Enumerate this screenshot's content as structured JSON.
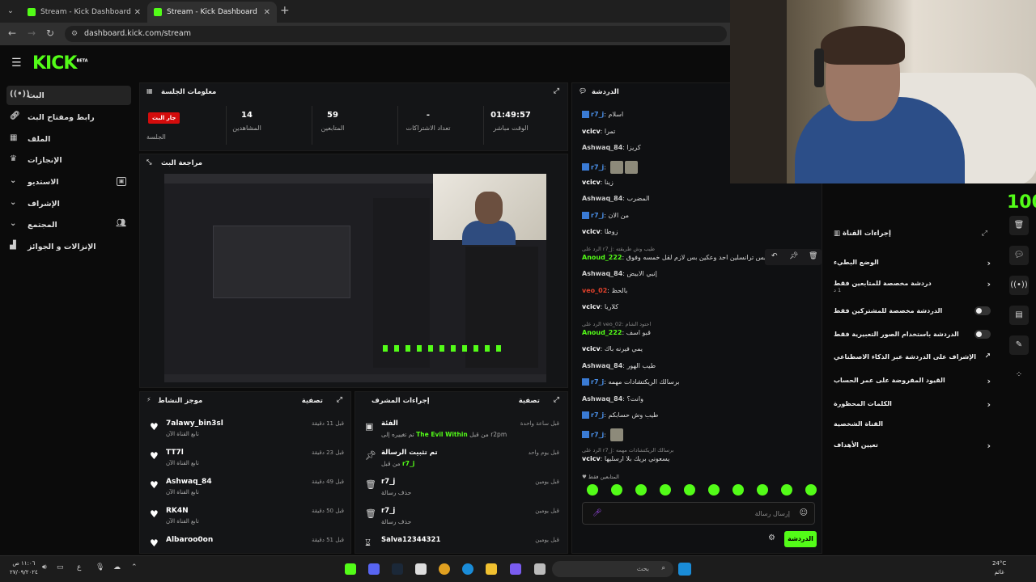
{
  "browser": {
    "tabs": [
      {
        "title": "Stream - Kick Dashboard"
      },
      {
        "title": "Stream - Kick Dashboard"
      }
    ],
    "url": "dashboard.kick.com/stream",
    "new_tab": "+",
    "close": "✕"
  },
  "logo": {
    "text": "KICK",
    "beta": "BETA"
  },
  "sidebar": {
    "items": [
      {
        "label": "البث",
        "icon": "stream-icon"
      },
      {
        "label": "رابط ومفتاح البث",
        "icon": "link-icon"
      },
      {
        "label": "الملف",
        "icon": "file-icon"
      },
      {
        "label": "الإنجازات",
        "icon": "trophy-icon"
      },
      {
        "label": "الاستديو",
        "icon": "chevron-down-icon"
      },
      {
        "label": "الإشراف",
        "icon": "chevron-down-icon"
      },
      {
        "label": "المجتمع",
        "icon": "chevron-down-icon"
      },
      {
        "label": "الإنزالات و الجوائز",
        "icon": "gift-icon"
      }
    ]
  },
  "session": {
    "title": "معلومات الجلسة",
    "live_badge": "جار البث",
    "session_label": "الجلسة",
    "stats": [
      {
        "value": "14",
        "label": "المشاهدين"
      },
      {
        "value": "59",
        "label": "المتابعين"
      },
      {
        "value": "-",
        "label": "تعداد الاشتراكات"
      },
      {
        "value": "01:49:57",
        "label": "الوقت مباشر"
      }
    ]
  },
  "preview": {
    "title": "مراجعة البث"
  },
  "activity": {
    "title": "موجز النشاط",
    "filter": "تصفية",
    "items": [
      {
        "name": "7alawy_bin3sl",
        "sub": "تابع القناة الآن",
        "time": "قبل 11 دقيقة"
      },
      {
        "name": "TT7l",
        "sub": "تابع القناة الآن",
        "time": "قبل 23 دقيقة"
      },
      {
        "name": "Ashwaq_84",
        "sub": "تابع القناة الآن",
        "time": "قبل 49 دقيقة"
      },
      {
        "name": "RK4N",
        "sub": "تابع القناة الآن",
        "time": "قبل 50 دقيقة"
      },
      {
        "name": "Albaroo0on",
        "sub": "",
        "time": "قبل 51 دقيقة"
      }
    ]
  },
  "moderation": {
    "title": "إجراءات المشرف",
    "filter": "تصفية",
    "items": [
      {
        "name": "الفئة",
        "sub_pre": "تم تغييره إلى ",
        "sub_hl": "The Evil Within",
        "sub_post": " من قبل r2pm",
        "time": "قبل ساعة واحدة",
        "icon": "category-icon"
      },
      {
        "name": "تم تثبيت الرسالة",
        "sub_pre": "من قبل ",
        "sub_hl": "r7_j",
        "sub_post": "",
        "time": "قبل يوم واحد",
        "icon": "pin-icon"
      },
      {
        "name": "r7_j",
        "sub_pre": "حذف رسالة",
        "sub_hl": "",
        "sub_post": "",
        "time": "قبل يومين",
        "icon": "trash-icon"
      },
      {
        "name": "r7_j",
        "sub_pre": "حذف رسالة",
        "sub_hl": "",
        "sub_post": "",
        "time": "قبل يومين",
        "icon": "trash-icon"
      },
      {
        "name": "Salva12344321",
        "sub_pre": "",
        "sub_hl": "",
        "sub_post": "",
        "time": "قبل يومين",
        "icon": "hourglass-icon"
      }
    ]
  },
  "chat": {
    "title": "الدردشة",
    "messages": [
      {
        "user": "r7_j",
        "color": "#4a8fe8",
        "text": "اسلام",
        "badge": true
      },
      {
        "user": "vcicv",
        "color": "#ffffff",
        "text": "تمرا",
        "badge": false
      },
      {
        "user": "Ashwaq_84",
        "color": "#cfcfcf",
        "text": "كريزا",
        "badge": false
      },
      {
        "user": "r7_j",
        "color": "#4a8fe8",
        "text": "",
        "badge": true,
        "emotes": 2
      },
      {
        "user": "vcicv",
        "color": "#ffffff",
        "text": "زينا",
        "badge": false
      },
      {
        "user": "Ashwaq_84",
        "color": "#cfcfcf",
        "text": "المضرب",
        "badge": false
      },
      {
        "user": "r7_j",
        "color": "#4a8fe8",
        "text": "من الان",
        "badge": true
      },
      {
        "user": "vcicv",
        "color": "#ffffff",
        "text": "زوطا",
        "badge": false
      },
      {
        "ref": "الرد على r7_j: طيب وش طريقته",
        "user": "Anoud_222",
        "color": "#53fc18",
        "text": "س جاكو بس ترانسلين احد وعكين بس لازم لقل خمسه وفوق",
        "badge": false
      },
      {
        "user": "Ashwaq_84",
        "color": "#cfcfcf",
        "text": "إنبي الابيض",
        "badge": false
      },
      {
        "user": "veo_02",
        "color": "#e0412b",
        "text": "بالحظ",
        "badge": false
      },
      {
        "user": "vcicv",
        "color": "#ffffff",
        "text": "كلاريا",
        "badge": false
      },
      {
        "ref": "الرد على veo_02: احتود الشام",
        "user": "Anoud_222",
        "color": "#53fc18",
        "text": "قبو اسف",
        "badge": false
      },
      {
        "user": "vcicv",
        "color": "#ffffff",
        "text": "يمي فيرنه باك",
        "badge": false
      },
      {
        "user": "Ashwaq_84",
        "color": "#cfcfcf",
        "text": "طيب الهور",
        "badge": false
      },
      {
        "user": "r7_j",
        "color": "#4a8fe8",
        "text": "برسالك الريكتشادات مهمه",
        "badge": true
      },
      {
        "user": "Ashwaq_84",
        "color": "#cfcfcf",
        "text": "وانت؟",
        "badge": false
      },
      {
        "user": "r7_j",
        "color": "#4a8fe8",
        "text": "طيب وش حسابكم",
        "badge": true
      },
      {
        "user": "r7_j",
        "color": "#4a8fe8",
        "text": "",
        "badge": true,
        "emotes": 1
      },
      {
        "ref": "الرد على r7_j: برسالك الريكتشادات مهمه",
        "user": "vcicv",
        "color": "#ffffff",
        "text": "يسعوني بريك بلا ارسليها",
        "badge": false
      }
    ],
    "followers_only": "المتابعين فقط",
    "input_placeholder": "إرسال رسالة",
    "send_label": "الدردشة"
  },
  "channel_actions": {
    "title": "إجراءات القناة",
    "rows": [
      {
        "label": "الوضع البطيء",
        "control": "chevron"
      },
      {
        "label": "دردشة مخصصة للمتابعين فقط",
        "sub": "1 د",
        "control": "chevron"
      },
      {
        "label": "الدردشة مخصصة للمشتركين فقط",
        "control": "toggle"
      },
      {
        "label": "الدردشة باستخدام الصور التعبيرية فقط",
        "control": "toggle"
      },
      {
        "label": "الإشراف على الدردشة عبر الذكاء الاصطناعي",
        "control": "external"
      },
      {
        "label": "القيود المفروضة على عمر الحساب",
        "control": "chevron"
      },
      {
        "label": "الكلمات المحظورة",
        "control": "chevron"
      },
      {
        "label": "القناة الشخصية",
        "control": "none"
      },
      {
        "label": "تعيين الأهداف",
        "control": "chevron"
      }
    ]
  },
  "overlay_number": "100",
  "taskbar": {
    "time": "١١:٠٦ ص",
    "date": "٢٧/٠٩/٢٠٢٤",
    "search_placeholder": "بحث",
    "temp": "24°C",
    "weather": "غائم"
  }
}
